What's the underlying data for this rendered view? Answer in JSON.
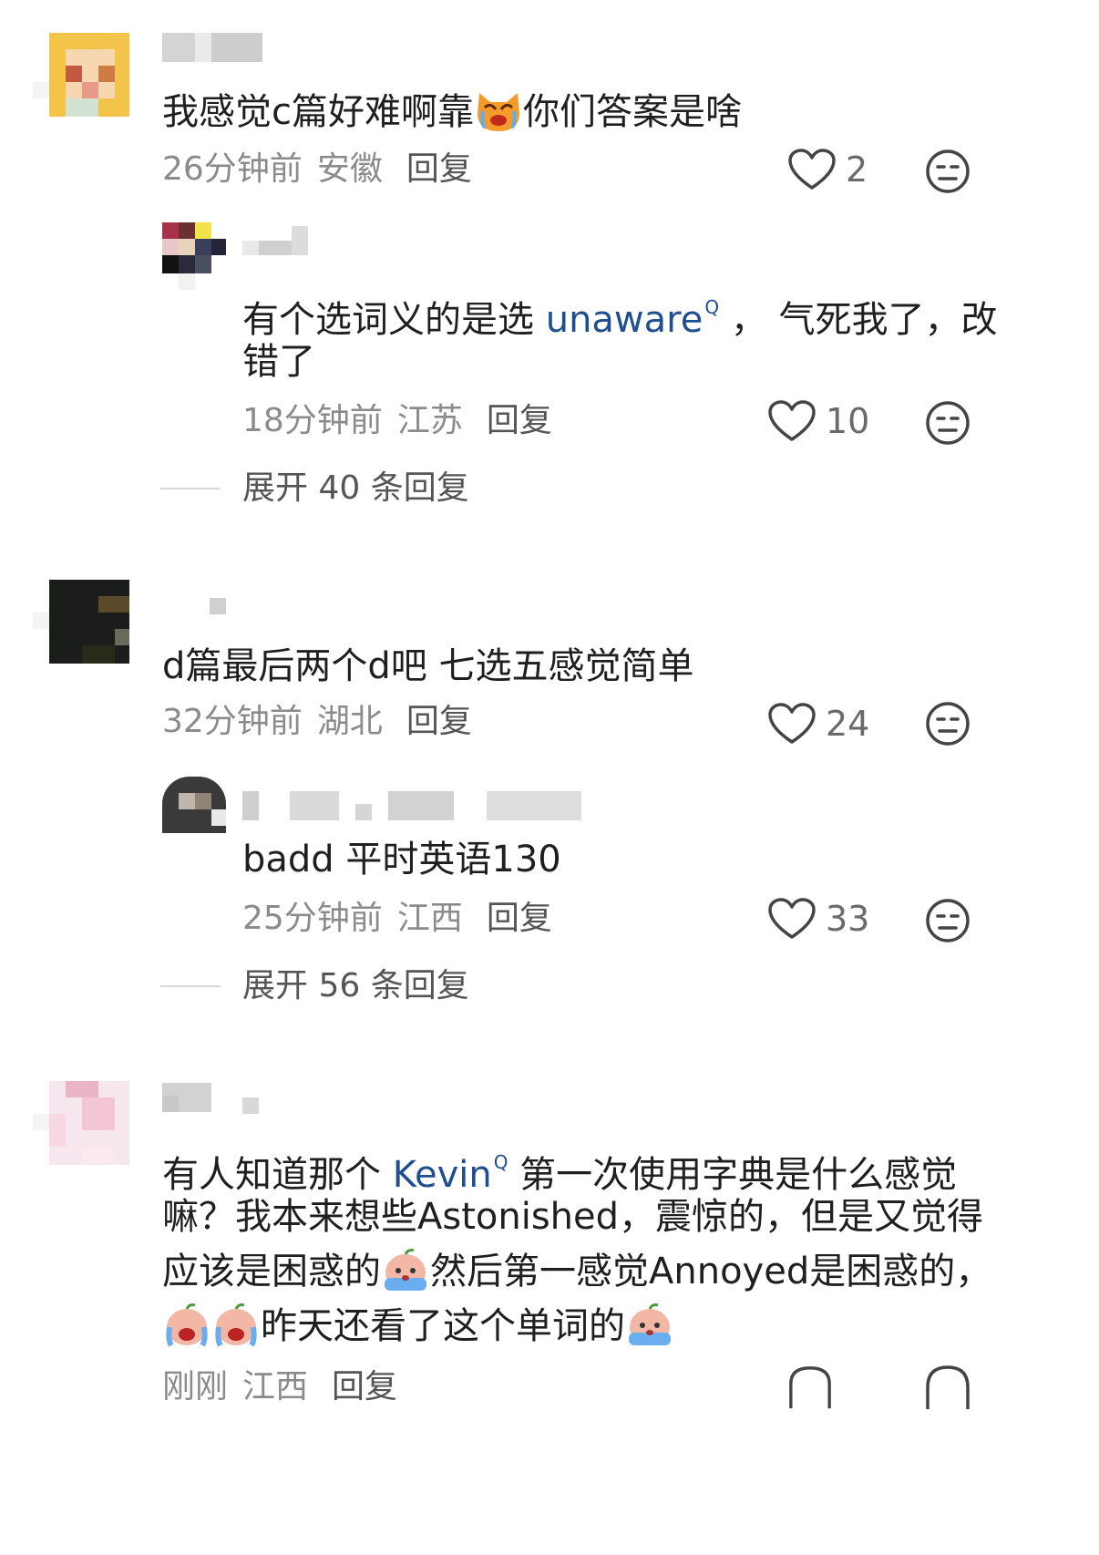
{
  "comments": [
    {
      "text": "我感觉c篇好难啊靠",
      "text_after": "你们答案是啥",
      "time": "26分钟前",
      "location": "安徽",
      "reply_label": "回复",
      "likes": "2",
      "replies": [
        {
          "line1_before": "有个选词义的是选 ",
          "keyword": "unaware",
          "line1_after": " ， 气死我了，改",
          "line2": "错了",
          "time": "18分钟前",
          "location": "江苏",
          "reply_label": "回复",
          "likes": "10"
        }
      ],
      "expand_label": "展开 40 条回复"
    },
    {
      "text": "d篇最后两个d吧 七选五感觉简单",
      "time": "32分钟前",
      "location": "湖北",
      "reply_label": "回复",
      "likes": "24",
      "replies": [
        {
          "text": "badd  平时英语130",
          "time": "25分钟前",
          "location": "江西",
          "reply_label": "回复",
          "likes": "33"
        }
      ],
      "expand_label": "展开 56 条回复"
    },
    {
      "line1_before": "有人知道那个 ",
      "keyword": "Kevin",
      "line1_after": " 第一次使用字典是什么感觉",
      "line2": "嘛？我本来想些Astonished，震惊的，但是又觉得",
      "line3_before": "应该是困惑的",
      "line3_after": "然后第一感觉Annoyed是困惑的，",
      "line4": "昨天还看了这个单词的",
      "time": "刚刚",
      "location": "江西",
      "reply_label": "回复"
    }
  ],
  "colors": {
    "keyword": "#1f4e91",
    "meta": "#8b8b8b",
    "text": "#1f1f1f"
  },
  "icons": [
    "heart-icon",
    "dislike-face-icon",
    "search-superscript-icon",
    "cat-crying-emoji",
    "sad-crying-emoji"
  ]
}
